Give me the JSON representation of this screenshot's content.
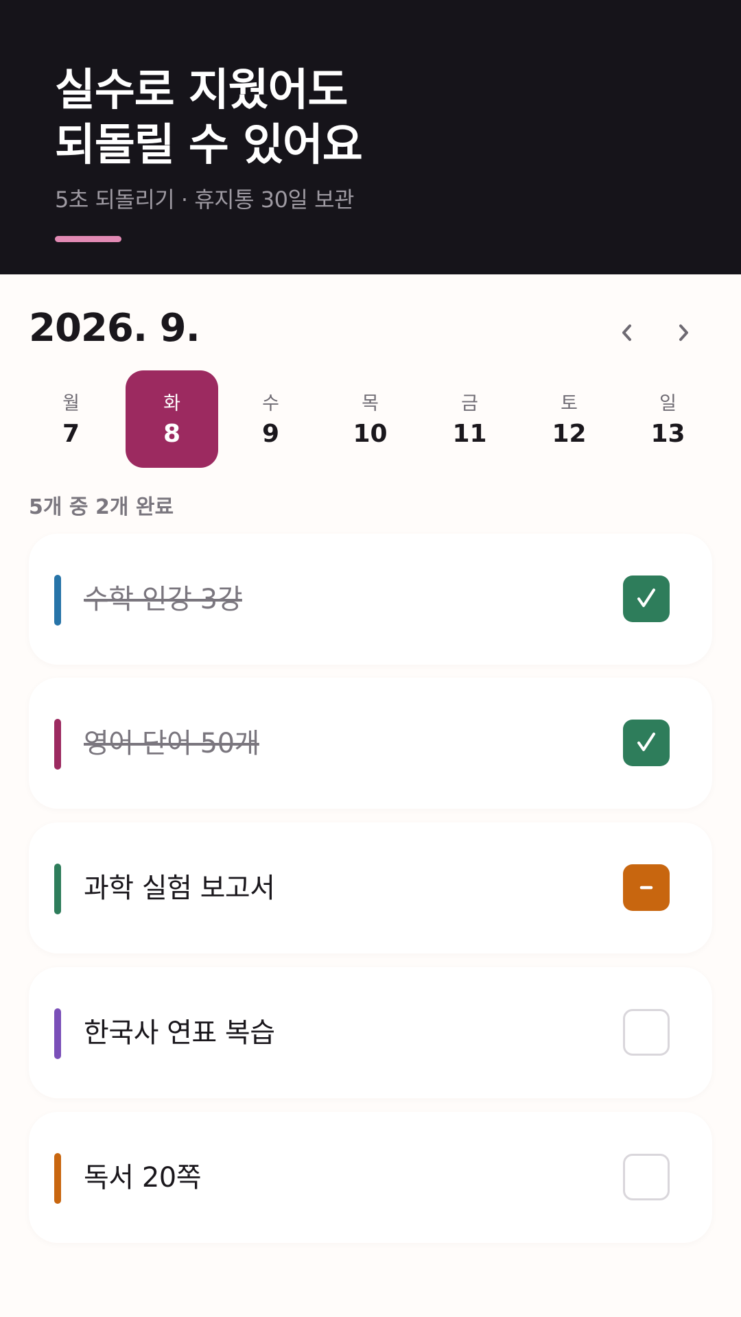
{
  "hero": {
    "title_line1": "실수로 지웠어도",
    "title_line2": "되돌릴 수 있어요",
    "subtitle": "5초 되돌리기 · 휴지통 30일 보관",
    "accent_color": "#E28AB4"
  },
  "calendar": {
    "month_label": "2026. 9.",
    "prev_icon": "chevron-left-icon",
    "next_icon": "chevron-right-icon",
    "selected_color": "#9C2A60",
    "days": [
      {
        "dow": "월",
        "num": "7",
        "selected": false
      },
      {
        "dow": "화",
        "num": "8",
        "selected": true
      },
      {
        "dow": "수",
        "num": "9",
        "selected": false
      },
      {
        "dow": "목",
        "num": "10",
        "selected": false
      },
      {
        "dow": "금",
        "num": "11",
        "selected": false
      },
      {
        "dow": "토",
        "num": "12",
        "selected": false
      },
      {
        "dow": "일",
        "num": "13",
        "selected": false
      }
    ]
  },
  "progress": {
    "text": "5개 중 2개 완료",
    "total": 5,
    "completed": 2
  },
  "tasks": [
    {
      "title": "수학 인강 3강",
      "color": "#2774A8",
      "state": "checked"
    },
    {
      "title": "영어 단어 50개",
      "color": "#9C2A60",
      "state": "checked"
    },
    {
      "title": "과학 실험 보고서",
      "color": "#2E7D5B",
      "state": "partial"
    },
    {
      "title": "한국사 연표 복습",
      "color": "#7A4FB8",
      "state": "empty"
    },
    {
      "title": "독서 20쪽",
      "color": "#C8660F",
      "state": "empty"
    }
  ],
  "state_colors": {
    "checked": "#2E7D5B",
    "partial": "#C8660F",
    "empty_border": "#D9D6DB"
  }
}
